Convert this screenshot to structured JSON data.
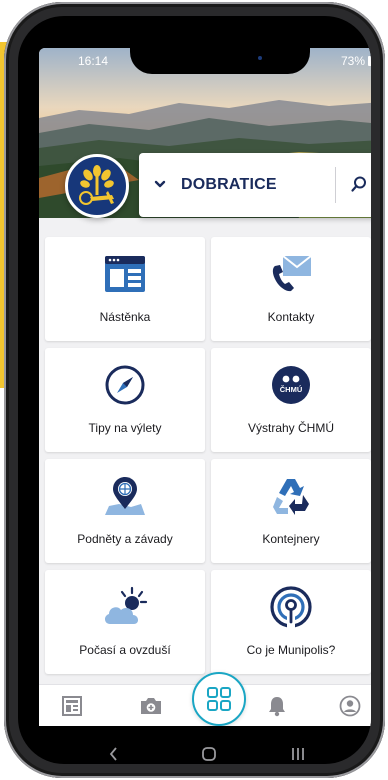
{
  "status_bar": {
    "time": "16:14",
    "battery": "73%"
  },
  "header": {
    "municipality": "DOBRATICE"
  },
  "tiles": [
    {
      "label": "Nástěnka",
      "icon": "bulletin-board-icon"
    },
    {
      "label": "Kontakty",
      "icon": "contacts-phone-icon"
    },
    {
      "label": "Tipy na výlety",
      "icon": "compass-icon"
    },
    {
      "label": "Výstrahy ČHMÚ",
      "icon": "chmu-badge-icon",
      "badge_text": "ČHMÚ"
    },
    {
      "label": "Podněty a závady",
      "icon": "map-pin-globe-icon"
    },
    {
      "label": "Kontejnery",
      "icon": "recycle-icon"
    },
    {
      "label": "Počasí a ovzduší",
      "icon": "weather-cloud-sun-icon"
    },
    {
      "label": "Co je Munipolis?",
      "icon": "broadcast-icon"
    }
  ],
  "bottom_nav": {
    "items": [
      "newspaper-icon",
      "camera-plus-icon",
      "grid-icon",
      "bell-icon",
      "profile-icon"
    ],
    "active": "grid-icon"
  },
  "colors": {
    "navy": "#1a2b5c",
    "blue": "#2f6fb8",
    "teal": "#1aa6c4",
    "screen_bg": "#f1f1f3"
  }
}
